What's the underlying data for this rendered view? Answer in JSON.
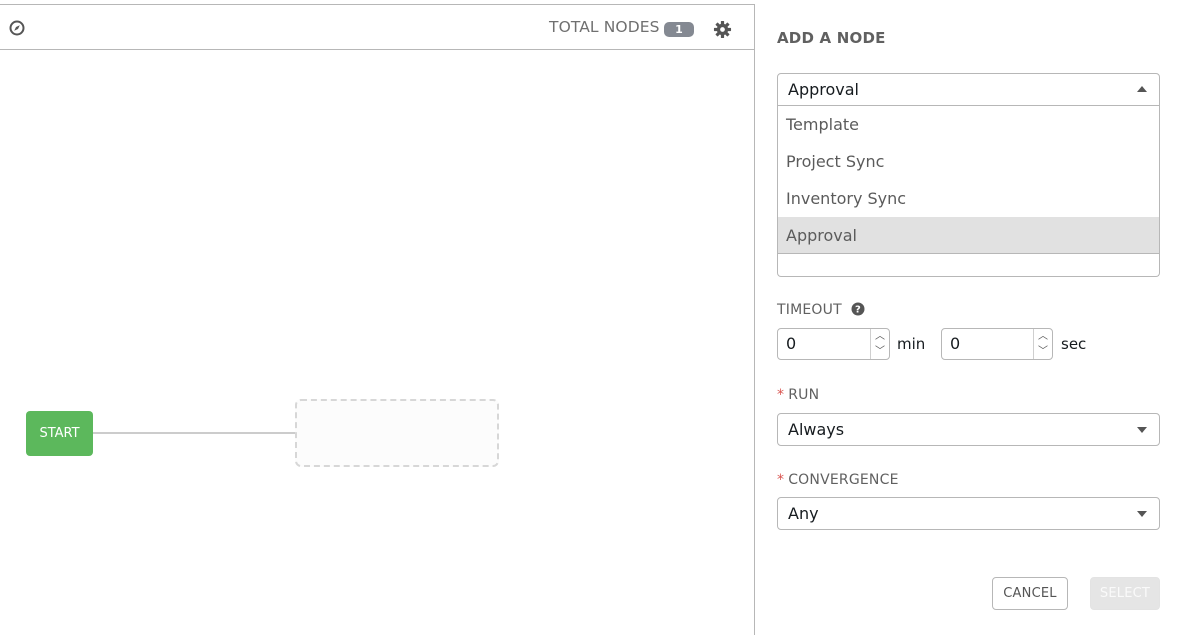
{
  "toolbar": {
    "total_nodes_label": "TOTAL NODES",
    "total_nodes_count": "1",
    "compass_icon": "compass-icon",
    "settings_icon": "gear-icon"
  },
  "canvas": {
    "start_label": "START",
    "start_color": "#5cb85c"
  },
  "form": {
    "title": "ADD A NODE",
    "node_type": {
      "selected": "Approval",
      "options": [
        "Template",
        "Project Sync",
        "Inventory Sync",
        "Approval"
      ]
    },
    "timeout": {
      "label": "TIMEOUT",
      "minutes": "0",
      "minutes_unit": "min",
      "seconds": "0",
      "seconds_unit": "sec"
    },
    "run": {
      "label": "RUN",
      "value": "Always"
    },
    "convergence": {
      "label": "CONVERGENCE",
      "value": "Any"
    },
    "buttons": {
      "cancel": "CANCEL",
      "select": "SELECT"
    },
    "required_color": "#d9534f"
  }
}
